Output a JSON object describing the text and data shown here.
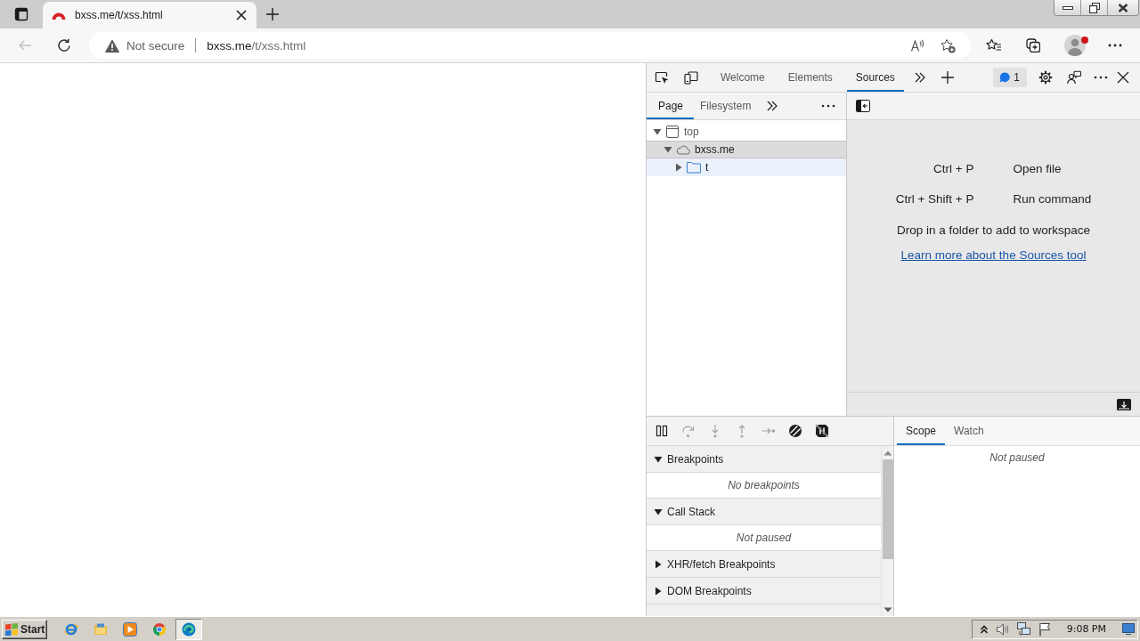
{
  "browser": {
    "tabs": [
      {
        "title": "bxss.me/t/xss.html",
        "selected": true
      }
    ],
    "back_button": {
      "disabled": true
    },
    "address_bar": {
      "security_label": "Not secure",
      "url_host": "bxss.me",
      "url_path": "/t/xss.html"
    },
    "profile": {
      "notification": true
    }
  },
  "devtools": {
    "panels": [
      {
        "label": "Welcome",
        "selected": false
      },
      {
        "label": "Elements",
        "selected": false
      },
      {
        "label": "Sources",
        "selected": true
      }
    ],
    "issues_count": "1",
    "navigator": {
      "tabs": [
        {
          "label": "Page",
          "selected": true
        },
        {
          "label": "Filesystem",
          "selected": false
        }
      ],
      "tree": [
        {
          "label": "top",
          "kind": "frame",
          "expanded": true,
          "selected": false,
          "hovered": false,
          "children": [
            {
              "label": "bxss.me",
              "kind": "domain",
              "expanded": true,
              "selected": true,
              "hovered": false,
              "children": [
                {
                  "label": "t",
                  "kind": "folder",
                  "expanded": false,
                  "selected": false,
                  "hovered": true
                }
              ]
            }
          ]
        }
      ]
    },
    "editor": {
      "shortcuts": [
        {
          "keys": "Ctrl + P",
          "action": "Open file"
        },
        {
          "keys": "Ctrl + Shift + P",
          "action": "Run command"
        }
      ],
      "drop_hint": "Drop in a folder to add to workspace",
      "link": "Learn more about the Sources tool"
    },
    "debugger": {
      "toolbar": [
        {
          "kind": "pause",
          "disabled": false
        },
        {
          "kind": "step_over",
          "disabled": true
        },
        {
          "kind": "step_into",
          "disabled": true
        },
        {
          "kind": "step_out",
          "disabled": true
        },
        {
          "kind": "step",
          "disabled": true
        },
        {
          "kind": "deactivate_breakpoints",
          "disabled": false
        },
        {
          "kind": "pause_on_exceptions",
          "disabled": false
        }
      ],
      "sections": [
        {
          "title": "Breakpoints",
          "expanded": true,
          "message": "No breakpoints"
        },
        {
          "title": "Call Stack",
          "expanded": true,
          "message": "Not paused"
        },
        {
          "title": "XHR/fetch Breakpoints",
          "expanded": false
        },
        {
          "title": "DOM Breakpoints",
          "expanded": false
        }
      ]
    },
    "sidebar": {
      "tabs": [
        {
          "label": "Scope",
          "selected": true
        },
        {
          "label": "Watch",
          "selected": false
        }
      ],
      "message": "Not paused"
    }
  },
  "taskbar": {
    "start_label": "Start",
    "quick_launch": [
      {
        "kind": "ie",
        "selected": false
      },
      {
        "kind": "explorer",
        "selected": false
      },
      {
        "kind": "media_player",
        "selected": false
      },
      {
        "kind": "chrome",
        "selected": false
      },
      {
        "kind": "edge",
        "selected": true
      }
    ],
    "clock": "9:08 PM"
  }
}
